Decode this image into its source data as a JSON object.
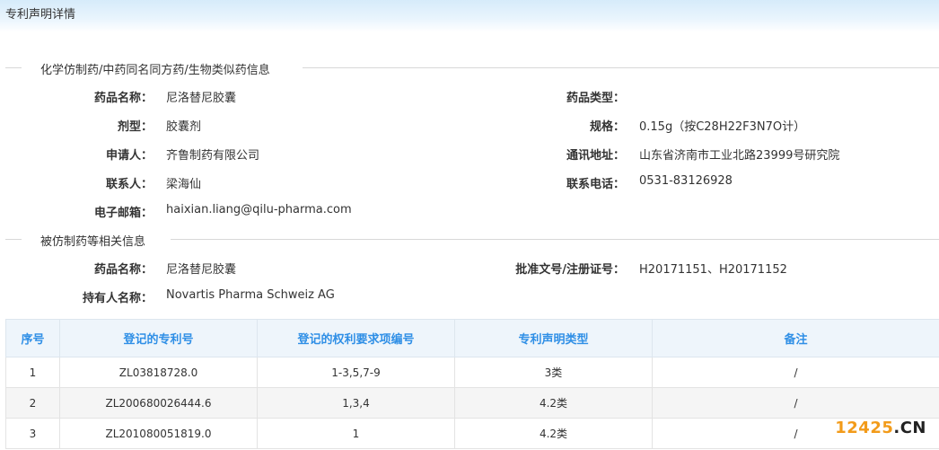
{
  "header": {
    "title": "专利声明详情"
  },
  "section1": {
    "title": "化学仿制药/中药同名同方药/生物类似药信息",
    "fields": {
      "drug_name": {
        "label": "药品名称：",
        "value": "尼洛替尼胶囊"
      },
      "drug_type": {
        "label": "药品类型：",
        "value": ""
      },
      "dosage_form": {
        "label": "剂型：",
        "value": "胶囊剂"
      },
      "spec": {
        "label": "规格：",
        "value": "0.15g（按C28H22F3N7O计）"
      },
      "applicant": {
        "label": "申请人：",
        "value": "齐鲁制药有限公司"
      },
      "address": {
        "label": "通讯地址：",
        "value": "山东省济南市工业北路23999号研究院"
      },
      "contact": {
        "label": "联系人：",
        "value": "梁海仙"
      },
      "phone": {
        "label": "联系电话：",
        "value": "0531-83126928"
      },
      "email": {
        "label": "电子邮箱：",
        "value": "haixian.liang@qilu-pharma.com"
      }
    }
  },
  "section2": {
    "title": "被仿制药等相关信息",
    "fields": {
      "drug_name": {
        "label": "药品名称：",
        "value": "尼洛替尼胶囊"
      },
      "approval_no": {
        "label": "批准文号/注册证号：",
        "value": "H20171151、H20171152"
      },
      "holder": {
        "label": "持有人名称：",
        "value": "Novartis Pharma Schweiz AG"
      }
    }
  },
  "table": {
    "headers": [
      "序号",
      "登记的专利号",
      "登记的权利要求项编号",
      "专利声明类型",
      "备注"
    ],
    "rows": [
      [
        "1",
        "ZL03818728.0",
        "1-3,5,7-9",
        "3类",
        "/"
      ],
      [
        "2",
        "ZL200680026444.6",
        "1,3,4",
        "4.2类",
        "/"
      ],
      [
        "3",
        "ZL201080051819.0",
        "1",
        "4.2类",
        "/"
      ]
    ]
  },
  "watermark": {
    "number": "12425",
    "suffix": ".CN"
  }
}
